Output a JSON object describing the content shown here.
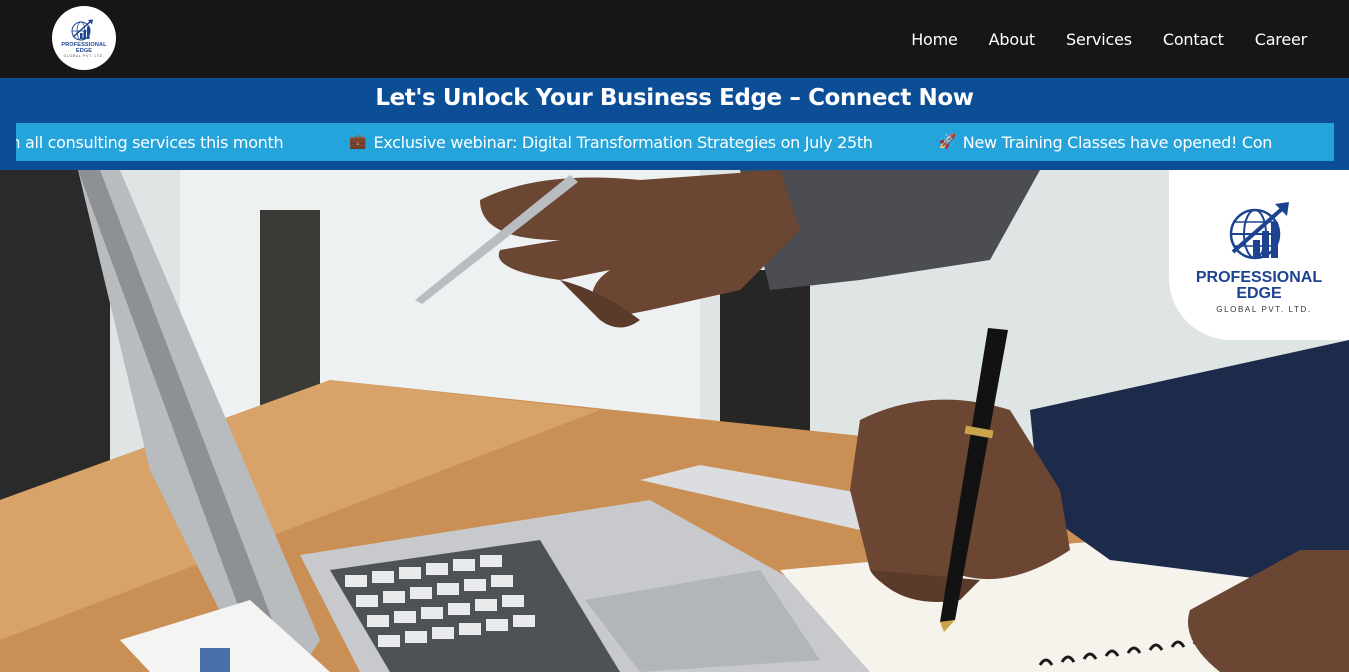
{
  "brand": {
    "name_line1": "PROFESSIONAL",
    "name_line2": "EDGE",
    "name_line3": "GLOBAL PVT. LTD.",
    "color": "#1d4390",
    "icon": "globe-growth-chart-icon"
  },
  "nav": {
    "items": [
      {
        "label": "Home"
      },
      {
        "label": "About"
      },
      {
        "label": "Services"
      },
      {
        "label": "Contact"
      },
      {
        "label": "Career"
      }
    ],
    "background": "#161616"
  },
  "banner": {
    "title": "Let's Unlock Your Business Edge – Connect Now",
    "background": "#0b4e96"
  },
  "ticker": {
    "background": "#25a4dc",
    "items": [
      {
        "icon": "",
        "text": "off on all consulting services this month"
      },
      {
        "icon": "briefcase-icon",
        "glyph": "💼",
        "text": "Exclusive webinar: Digital Transformation Strategies on July 25th"
      },
      {
        "icon": "rocket-icon",
        "glyph": "🚀",
        "text": "New Training Classes have opened! Con"
      }
    ]
  },
  "hero": {
    "image": "photo-laptop-pen-notebook"
  }
}
